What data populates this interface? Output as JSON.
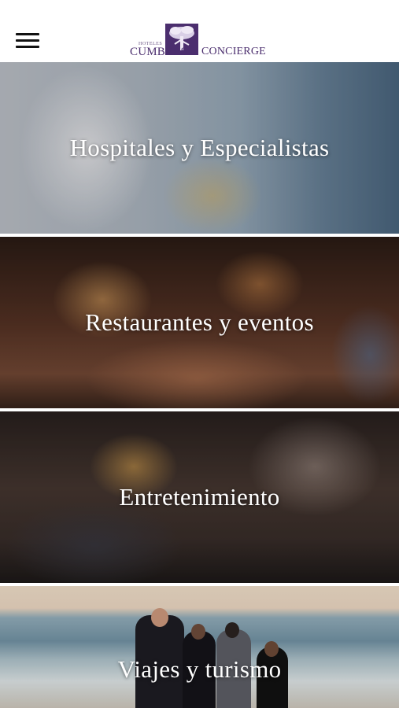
{
  "header": {
    "menu_icon": "hamburger-menu-icon",
    "logo": {
      "small_text": "HOTELES",
      "left_text": "CUMBRES",
      "right_text": "CONCIERGE",
      "brand_color": "#4b2e6e"
    }
  },
  "categories": [
    {
      "label": "Hospitales y Especialistas"
    },
    {
      "label": "Restaurantes y eventos"
    },
    {
      "label": "Entretenimiento"
    },
    {
      "label": "Viajes y turismo"
    }
  ]
}
